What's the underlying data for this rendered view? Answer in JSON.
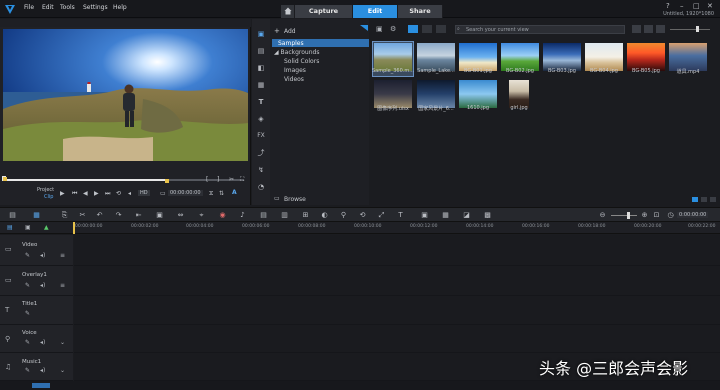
{
  "menu": [
    "File",
    "Edit",
    "Tools",
    "Settings",
    "Help"
  ],
  "tabs": {
    "capture": "Capture",
    "edit": "Edit",
    "share": "Share"
  },
  "project_info": "Untitled, 1920*1080",
  "player": {
    "mode_project": "Project",
    "mode_clip": "Clip",
    "timecode": "00:00:00:00",
    "quality": "HD"
  },
  "nav": {
    "add_label": "Add",
    "items": [
      "Samples",
      "Backgrounds",
      "Solid Colors",
      "Images",
      "Videos"
    ],
    "browse_label": "Browse"
  },
  "library": {
    "search_placeholder": "Search your current view",
    "thumbs_row1": [
      "Sample_360.m...",
      "Sample_Lake...",
      "BG-B01.jpg",
      "BG-B02.jpg",
      "BG-B03.jpg",
      "BG-B04.jpg",
      "BG-B05.jpg",
      "道具.mp4"
    ],
    "thumbs_row2": [
      "图像序列.uisx",
      "国家风景片_6...",
      "1610.jpg",
      "girl.jpg"
    ]
  },
  "ruler": [
    "00:00:00:00",
    "00:00:02:00",
    "00:00:04:00",
    "00:00:06:00",
    "00:00:08:00",
    "00:00:10:00",
    "00:00:12:00",
    "00:00:14:00",
    "00:00:16:00",
    "00:00:18:00",
    "00:00:20:00",
    "00:00:22:00"
  ],
  "timeline": {
    "zoom_timecode": "0:00:00:00",
    "tracks": [
      "Video",
      "Overlay1",
      "Title1",
      "Voice",
      "Music1"
    ]
  },
  "watermark": "头条 @三郎会声会影",
  "colors": {
    "accent": "#2a8fe0",
    "panel": "#1b1c20",
    "selection": "#2f6fb0"
  }
}
